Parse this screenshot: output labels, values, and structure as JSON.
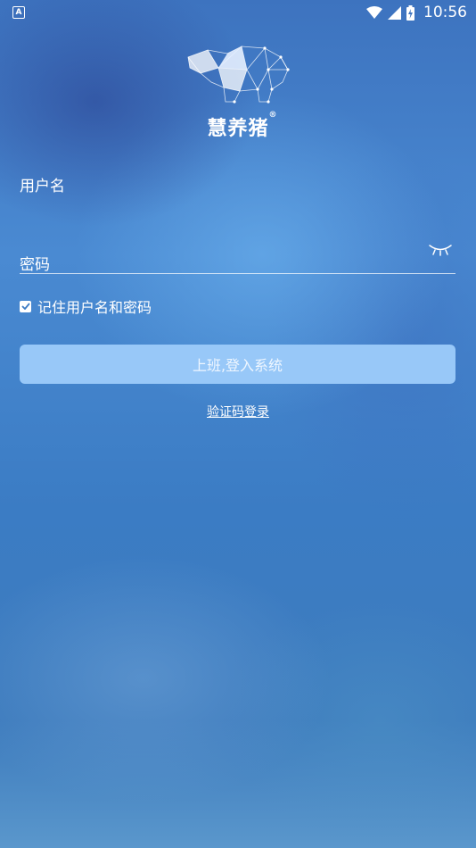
{
  "status_bar": {
    "notification_icon": "a-icon",
    "wifi_icon": "wifi-icon",
    "signal_icon": "signal-icon",
    "battery_icon": "battery-charging-icon",
    "time": "10:56"
  },
  "logo": {
    "icon": "polygon-pig-icon",
    "text": "慧养猪",
    "mark": "®"
  },
  "form": {
    "username_label": "用户名",
    "password_label": "密码",
    "password_toggle_icon": "eye-closed-icon",
    "remember_checked": true,
    "remember_label": "记住用户名和密码",
    "login_button": "上班,登入系统",
    "sms_login_link": "验证码登录"
  },
  "colors": {
    "button_bg": "#98c8f8",
    "text": "#ffffff"
  }
}
